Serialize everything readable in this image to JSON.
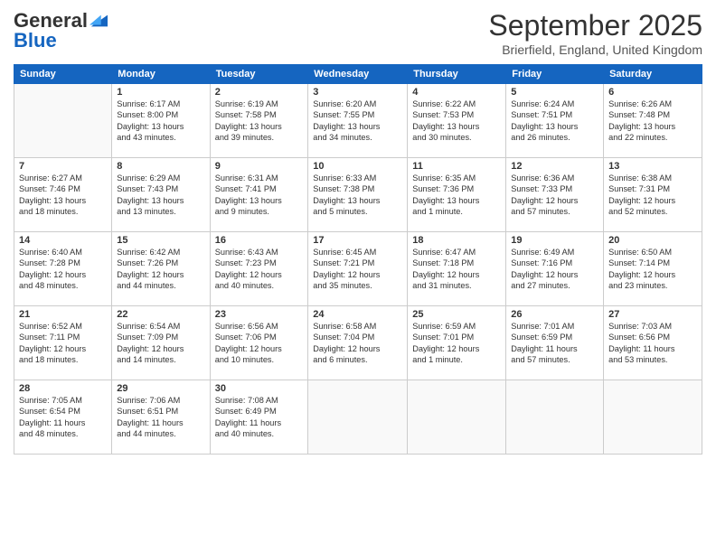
{
  "logo": {
    "general": "General",
    "blue": "Blue"
  },
  "header": {
    "month": "September 2025",
    "location": "Brierfield, England, United Kingdom"
  },
  "weekdays": [
    "Sunday",
    "Monday",
    "Tuesday",
    "Wednesday",
    "Thursday",
    "Friday",
    "Saturday"
  ],
  "weeks": [
    [
      {
        "day": "",
        "info": ""
      },
      {
        "day": "1",
        "info": "Sunrise: 6:17 AM\nSunset: 8:00 PM\nDaylight: 13 hours\nand 43 minutes."
      },
      {
        "day": "2",
        "info": "Sunrise: 6:19 AM\nSunset: 7:58 PM\nDaylight: 13 hours\nand 39 minutes."
      },
      {
        "day": "3",
        "info": "Sunrise: 6:20 AM\nSunset: 7:55 PM\nDaylight: 13 hours\nand 34 minutes."
      },
      {
        "day": "4",
        "info": "Sunrise: 6:22 AM\nSunset: 7:53 PM\nDaylight: 13 hours\nand 30 minutes."
      },
      {
        "day": "5",
        "info": "Sunrise: 6:24 AM\nSunset: 7:51 PM\nDaylight: 13 hours\nand 26 minutes."
      },
      {
        "day": "6",
        "info": "Sunrise: 6:26 AM\nSunset: 7:48 PM\nDaylight: 13 hours\nand 22 minutes."
      }
    ],
    [
      {
        "day": "7",
        "info": "Sunrise: 6:27 AM\nSunset: 7:46 PM\nDaylight: 13 hours\nand 18 minutes."
      },
      {
        "day": "8",
        "info": "Sunrise: 6:29 AM\nSunset: 7:43 PM\nDaylight: 13 hours\nand 13 minutes."
      },
      {
        "day": "9",
        "info": "Sunrise: 6:31 AM\nSunset: 7:41 PM\nDaylight: 13 hours\nand 9 minutes."
      },
      {
        "day": "10",
        "info": "Sunrise: 6:33 AM\nSunset: 7:38 PM\nDaylight: 13 hours\nand 5 minutes."
      },
      {
        "day": "11",
        "info": "Sunrise: 6:35 AM\nSunset: 7:36 PM\nDaylight: 13 hours\nand 1 minute."
      },
      {
        "day": "12",
        "info": "Sunrise: 6:36 AM\nSunset: 7:33 PM\nDaylight: 12 hours\nand 57 minutes."
      },
      {
        "day": "13",
        "info": "Sunrise: 6:38 AM\nSunset: 7:31 PM\nDaylight: 12 hours\nand 52 minutes."
      }
    ],
    [
      {
        "day": "14",
        "info": "Sunrise: 6:40 AM\nSunset: 7:28 PM\nDaylight: 12 hours\nand 48 minutes."
      },
      {
        "day": "15",
        "info": "Sunrise: 6:42 AM\nSunset: 7:26 PM\nDaylight: 12 hours\nand 44 minutes."
      },
      {
        "day": "16",
        "info": "Sunrise: 6:43 AM\nSunset: 7:23 PM\nDaylight: 12 hours\nand 40 minutes."
      },
      {
        "day": "17",
        "info": "Sunrise: 6:45 AM\nSunset: 7:21 PM\nDaylight: 12 hours\nand 35 minutes."
      },
      {
        "day": "18",
        "info": "Sunrise: 6:47 AM\nSunset: 7:18 PM\nDaylight: 12 hours\nand 31 minutes."
      },
      {
        "day": "19",
        "info": "Sunrise: 6:49 AM\nSunset: 7:16 PM\nDaylight: 12 hours\nand 27 minutes."
      },
      {
        "day": "20",
        "info": "Sunrise: 6:50 AM\nSunset: 7:14 PM\nDaylight: 12 hours\nand 23 minutes."
      }
    ],
    [
      {
        "day": "21",
        "info": "Sunrise: 6:52 AM\nSunset: 7:11 PM\nDaylight: 12 hours\nand 18 minutes."
      },
      {
        "day": "22",
        "info": "Sunrise: 6:54 AM\nSunset: 7:09 PM\nDaylight: 12 hours\nand 14 minutes."
      },
      {
        "day": "23",
        "info": "Sunrise: 6:56 AM\nSunset: 7:06 PM\nDaylight: 12 hours\nand 10 minutes."
      },
      {
        "day": "24",
        "info": "Sunrise: 6:58 AM\nSunset: 7:04 PM\nDaylight: 12 hours\nand 6 minutes."
      },
      {
        "day": "25",
        "info": "Sunrise: 6:59 AM\nSunset: 7:01 PM\nDaylight: 12 hours\nand 1 minute."
      },
      {
        "day": "26",
        "info": "Sunrise: 7:01 AM\nSunset: 6:59 PM\nDaylight: 11 hours\nand 57 minutes."
      },
      {
        "day": "27",
        "info": "Sunrise: 7:03 AM\nSunset: 6:56 PM\nDaylight: 11 hours\nand 53 minutes."
      }
    ],
    [
      {
        "day": "28",
        "info": "Sunrise: 7:05 AM\nSunset: 6:54 PM\nDaylight: 11 hours\nand 48 minutes."
      },
      {
        "day": "29",
        "info": "Sunrise: 7:06 AM\nSunset: 6:51 PM\nDaylight: 11 hours\nand 44 minutes."
      },
      {
        "day": "30",
        "info": "Sunrise: 7:08 AM\nSunset: 6:49 PM\nDaylight: 11 hours\nand 40 minutes."
      },
      {
        "day": "",
        "info": ""
      },
      {
        "day": "",
        "info": ""
      },
      {
        "day": "",
        "info": ""
      },
      {
        "day": "",
        "info": ""
      }
    ]
  ]
}
